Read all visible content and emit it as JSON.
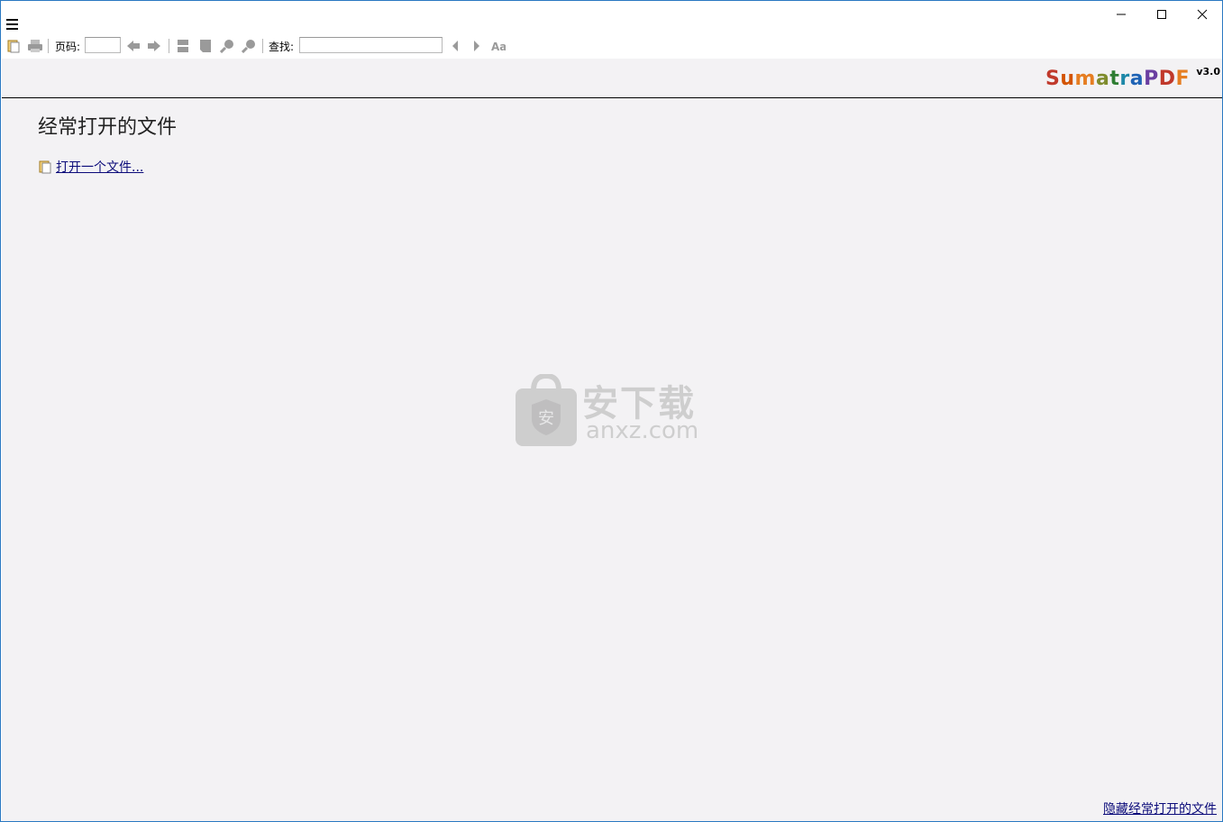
{
  "toolbar": {
    "page_label": "页码:",
    "page_value": "",
    "find_label": "查找:",
    "find_value": ""
  },
  "logo": {
    "name_parts": [
      "S",
      "u",
      "m",
      "a",
      "t",
      "r",
      "a",
      "P",
      "D",
      "F"
    ],
    "name_colors": [
      "#c0392b",
      "#d35400",
      "#e67e22",
      "#7f8c2d",
      "#2e7d32",
      "#1e88a8",
      "#1e63b5",
      "#6a3ea1",
      "#c0392b",
      "#e67e22"
    ],
    "version": "v3.0"
  },
  "main": {
    "heading": "经常打开的文件",
    "open_file_link": "打开一个文件...",
    "hide_link": "隐藏经常打开的文件"
  },
  "watermark": {
    "big": "安下载",
    "small": "anxz.com",
    "badge": "安"
  },
  "colors": {
    "background": "#f3f2f4",
    "link": "#0b0b7a",
    "window_border": "#2a79c2"
  }
}
